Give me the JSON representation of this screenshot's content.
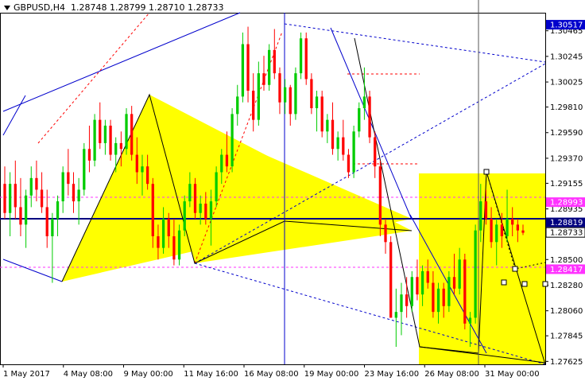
{
  "header": {
    "symbol": "GBPUSD,H4",
    "open": "1.28748",
    "high": "1.28799",
    "low": "1.28710",
    "close": "1.28733"
  },
  "colors": {
    "background": "#ffffff",
    "bull": "#00cc00",
    "bear": "#ff0000",
    "zone": "#ffff00",
    "trendline": "#0000cc",
    "pattern": "#000000",
    "current_price_label": "#000080"
  },
  "chart_data": {
    "type": "candlestick",
    "symbol": "GBPUSD",
    "timeframe": "H4",
    "ylim": [
      1.276,
      1.3062
    ],
    "y_ticks": [
      "1.30465",
      "1.30245",
      "1.30025",
      "1.29810",
      "1.29590",
      "1.29370",
      "1.29155",
      "1.28935",
      "1.28715",
      "1.28500",
      "1.28280",
      "1.28060",
      "1.27845",
      "1.27625"
    ],
    "x_ticks": [
      "1 May 2017",
      "4 May 08:00",
      "9 May 00:00",
      "11 May 16:00",
      "16 May 08:00",
      "19 May 00:00",
      "23 May 16:00",
      "26 May 08:00",
      "31 May 00:00"
    ],
    "price_labels": [
      {
        "value": "1.30517",
        "color": "#0000cc"
      },
      {
        "value": "1.28993",
        "color": "#ff33ff"
      },
      {
        "value": "1.28819",
        "color": "#000080"
      },
      {
        "value": "1.28733",
        "color": "#000000"
      },
      {
        "value": "1.28417",
        "color": "#ff33ff"
      }
    ],
    "series": [
      {
        "name": "GBPUSD",
        "candles": [
          {
            "o": 1.2915,
            "h": 1.293,
            "l": 1.2885,
            "c": 1.289
          },
          {
            "o": 1.289,
            "h": 1.2925,
            "l": 1.287,
            "c": 1.2915
          },
          {
            "o": 1.2915,
            "h": 1.2935,
            "l": 1.2885,
            "c": 1.2895
          },
          {
            "o": 1.2895,
            "h": 1.292,
            "l": 1.287,
            "c": 1.288
          },
          {
            "o": 1.288,
            "h": 1.291,
            "l": 1.286,
            "c": 1.2905
          },
          {
            "o": 1.2905,
            "h": 1.293,
            "l": 1.2895,
            "c": 1.292
          },
          {
            "o": 1.292,
            "h": 1.2935,
            "l": 1.29,
            "c": 1.291
          },
          {
            "o": 1.291,
            "h": 1.2925,
            "l": 1.289,
            "c": 1.2895
          },
          {
            "o": 1.2895,
            "h": 1.291,
            "l": 1.286,
            "c": 1.287
          },
          {
            "o": 1.287,
            "h": 1.289,
            "l": 1.283,
            "c": 1.2885
          },
          {
            "o": 1.2885,
            "h": 1.2905,
            "l": 1.287,
            "c": 1.29
          },
          {
            "o": 1.29,
            "h": 1.293,
            "l": 1.289,
            "c": 1.2925
          },
          {
            "o": 1.2925,
            "h": 1.2945,
            "l": 1.2905,
            "c": 1.2915
          },
          {
            "o": 1.2915,
            "h": 1.2925,
            "l": 1.289,
            "c": 1.29
          },
          {
            "o": 1.29,
            "h": 1.292,
            "l": 1.288,
            "c": 1.291
          },
          {
            "o": 1.291,
            "h": 1.295,
            "l": 1.2905,
            "c": 1.2945
          },
          {
            "o": 1.2945,
            "h": 1.2965,
            "l": 1.2925,
            "c": 1.2935
          },
          {
            "o": 1.2935,
            "h": 1.2975,
            "l": 1.293,
            "c": 1.297
          },
          {
            "o": 1.297,
            "h": 1.2985,
            "l": 1.2945,
            "c": 1.295
          },
          {
            "o": 1.295,
            "h": 1.297,
            "l": 1.294,
            "c": 1.2965
          },
          {
            "o": 1.2965,
            "h": 1.297,
            "l": 1.2935,
            "c": 1.294
          },
          {
            "o": 1.294,
            "h": 1.2955,
            "l": 1.2925,
            "c": 1.295
          },
          {
            "o": 1.295,
            "h": 1.296,
            "l": 1.293,
            "c": 1.2945
          },
          {
            "o": 1.2945,
            "h": 1.298,
            "l": 1.294,
            "c": 1.2975
          },
          {
            "o": 1.2975,
            "h": 1.2982,
            "l": 1.2935,
            "c": 1.294
          },
          {
            "o": 1.294,
            "h": 1.2955,
            "l": 1.2915,
            "c": 1.2925
          },
          {
            "o": 1.2925,
            "h": 1.294,
            "l": 1.2905,
            "c": 1.293
          },
          {
            "o": 1.293,
            "h": 1.294,
            "l": 1.291,
            "c": 1.2915
          },
          {
            "o": 1.2915,
            "h": 1.292,
            "l": 1.286,
            "c": 1.287
          },
          {
            "o": 1.287,
            "h": 1.288,
            "l": 1.285,
            "c": 1.286
          },
          {
            "o": 1.286,
            "h": 1.2895,
            "l": 1.2855,
            "c": 1.2885
          },
          {
            "o": 1.2885,
            "h": 1.289,
            "l": 1.286,
            "c": 1.287
          },
          {
            "o": 1.287,
            "h": 1.2885,
            "l": 1.2845,
            "c": 1.285
          },
          {
            "o": 1.285,
            "h": 1.288,
            "l": 1.2845,
            "c": 1.2875
          },
          {
            "o": 1.2875,
            "h": 1.2905,
            "l": 1.287,
            "c": 1.29
          },
          {
            "o": 1.29,
            "h": 1.2925,
            "l": 1.2895,
            "c": 1.2915
          },
          {
            "o": 1.2915,
            "h": 1.292,
            "l": 1.2885,
            "c": 1.289
          },
          {
            "o": 1.289,
            "h": 1.2905,
            "l": 1.288,
            "c": 1.2898
          },
          {
            "o": 1.2898,
            "h": 1.2908,
            "l": 1.288,
            "c": 1.2885
          },
          {
            "o": 1.2885,
            "h": 1.291,
            "l": 1.2862,
            "c": 1.29
          },
          {
            "o": 1.29,
            "h": 1.293,
            "l": 1.2895,
            "c": 1.2925
          },
          {
            "o": 1.2925,
            "h": 1.2945,
            "l": 1.2915,
            "c": 1.294
          },
          {
            "o": 1.294,
            "h": 1.296,
            "l": 1.2925,
            "c": 1.293
          },
          {
            "o": 1.293,
            "h": 1.298,
            "l": 1.2925,
            "c": 1.2975
          },
          {
            "o": 1.2975,
            "h": 1.3,
            "l": 1.2965,
            "c": 1.299
          },
          {
            "o": 1.299,
            "h": 1.3045,
            "l": 1.2985,
            "c": 1.3035
          },
          {
            "o": 1.3035,
            "h": 1.305,
            "l": 1.2985,
            "c": 1.2995
          },
          {
            "o": 1.2995,
            "h": 1.301,
            "l": 1.296,
            "c": 1.297
          },
          {
            "o": 1.297,
            "h": 1.302,
            "l": 1.2965,
            "c": 1.301
          },
          {
            "o": 1.301,
            "h": 1.3025,
            "l": 1.2995,
            "c": 1.3
          },
          {
            "o": 1.3,
            "h": 1.3035,
            "l": 1.2995,
            "c": 1.303
          },
          {
            "o": 1.303,
            "h": 1.3048,
            "l": 1.3005,
            "c": 1.301
          },
          {
            "o": 1.301,
            "h": 1.3015,
            "l": 1.2975,
            "c": 1.2985
          },
          {
            "o": 1.2985,
            "h": 1.3005,
            "l": 1.2975,
            "c": 1.2998
          },
          {
            "o": 1.2998,
            "h": 1.3,
            "l": 1.2965,
            "c": 1.2975
          },
          {
            "o": 1.2975,
            "h": 1.3015,
            "l": 1.297,
            "c": 1.301
          },
          {
            "o": 1.301,
            "h": 1.3045,
            "l": 1.3005,
            "c": 1.304
          },
          {
            "o": 1.304,
            "h": 1.3045,
            "l": 1.3,
            "c": 1.3005
          },
          {
            "o": 1.3005,
            "h": 1.301,
            "l": 1.2975,
            "c": 1.298
          },
          {
            "o": 1.298,
            "h": 1.2995,
            "l": 1.296,
            "c": 1.299
          },
          {
            "o": 1.299,
            "h": 1.2995,
            "l": 1.2955,
            "c": 1.296
          },
          {
            "o": 1.296,
            "h": 1.2975,
            "l": 1.295,
            "c": 1.297
          },
          {
            "o": 1.297,
            "h": 1.2985,
            "l": 1.294,
            "c": 1.2945
          },
          {
            "o": 1.2945,
            "h": 1.296,
            "l": 1.2935,
            "c": 1.2955
          },
          {
            "o": 1.2955,
            "h": 1.297,
            "l": 1.2935,
            "c": 1.294
          },
          {
            "o": 1.294,
            "h": 1.2945,
            "l": 1.292,
            "c": 1.2925
          },
          {
            "o": 1.2925,
            "h": 1.2965,
            "l": 1.292,
            "c": 1.296
          },
          {
            "o": 1.296,
            "h": 1.2985,
            "l": 1.2955,
            "c": 1.298
          },
          {
            "o": 1.298,
            "h": 1.3015,
            "l": 1.297,
            "c": 1.299
          },
          {
            "o": 1.299,
            "h": 1.2995,
            "l": 1.295,
            "c": 1.2955
          },
          {
            "o": 1.2955,
            "h": 1.296,
            "l": 1.292,
            "c": 1.293
          },
          {
            "o": 1.293,
            "h": 1.2935,
            "l": 1.287,
            "c": 1.288
          },
          {
            "o": 1.288,
            "h": 1.2885,
            "l": 1.2855,
            "c": 1.2865
          },
          {
            "o": 1.2865,
            "h": 1.287,
            "l": 1.2815,
            "c": 1.28
          },
          {
            "o": 1.28,
            "h": 1.2825,
            "l": 1.2775,
            "c": 1.2805
          },
          {
            "o": 1.2805,
            "h": 1.283,
            "l": 1.2785,
            "c": 1.282
          },
          {
            "o": 1.282,
            "h": 1.2835,
            "l": 1.28,
            "c": 1.281
          },
          {
            "o": 1.281,
            "h": 1.284,
            "l": 1.2805,
            "c": 1.2835
          },
          {
            "o": 1.2835,
            "h": 1.285,
            "l": 1.2815,
            "c": 1.282
          },
          {
            "o": 1.282,
            "h": 1.2845,
            "l": 1.281,
            "c": 1.284
          },
          {
            "o": 1.284,
            "h": 1.285,
            "l": 1.2825,
            "c": 1.283
          },
          {
            "o": 1.283,
            "h": 1.284,
            "l": 1.28,
            "c": 1.2805
          },
          {
            "o": 1.2805,
            "h": 1.283,
            "l": 1.2795,
            "c": 1.2825
          },
          {
            "o": 1.2825,
            "h": 1.283,
            "l": 1.28,
            "c": 1.281
          },
          {
            "o": 1.281,
            "h": 1.284,
            "l": 1.2805,
            "c": 1.2835
          },
          {
            "o": 1.2835,
            "h": 1.2855,
            "l": 1.282,
            "c": 1.2825
          },
          {
            "o": 1.2825,
            "h": 1.286,
            "l": 1.282,
            "c": 1.285
          },
          {
            "o": 1.285,
            "h": 1.2855,
            "l": 1.279,
            "c": 1.2795
          },
          {
            "o": 1.2795,
            "h": 1.2805,
            "l": 1.2775,
            "c": 1.28
          },
          {
            "o": 1.28,
            "h": 1.288,
            "l": 1.2795,
            "c": 1.2875
          },
          {
            "o": 1.2875,
            "h": 1.2915,
            "l": 1.2865,
            "c": 1.29
          },
          {
            "o": 1.29,
            "h": 1.291,
            "l": 1.288,
            "c": 1.2885
          },
          {
            "o": 1.2885,
            "h": 1.2895,
            "l": 1.286,
            "c": 1.2865
          },
          {
            "o": 1.2865,
            "h": 1.2885,
            "l": 1.2845,
            "c": 1.288
          },
          {
            "o": 1.288,
            "h": 1.289,
            "l": 1.286,
            "c": 1.287
          },
          {
            "o": 1.287,
            "h": 1.291,
            "l": 1.2865,
            "c": 1.2885
          },
          {
            "o": 1.2885,
            "h": 1.2895,
            "l": 1.287,
            "c": 1.288
          },
          {
            "o": 1.288,
            "h": 1.2885,
            "l": 1.2865,
            "c": 1.2875
          },
          {
            "o": 1.2875,
            "h": 1.288,
            "l": 1.2871,
            "c": 1.2873
          }
        ]
      }
    ],
    "grid": false,
    "legend": "none"
  }
}
